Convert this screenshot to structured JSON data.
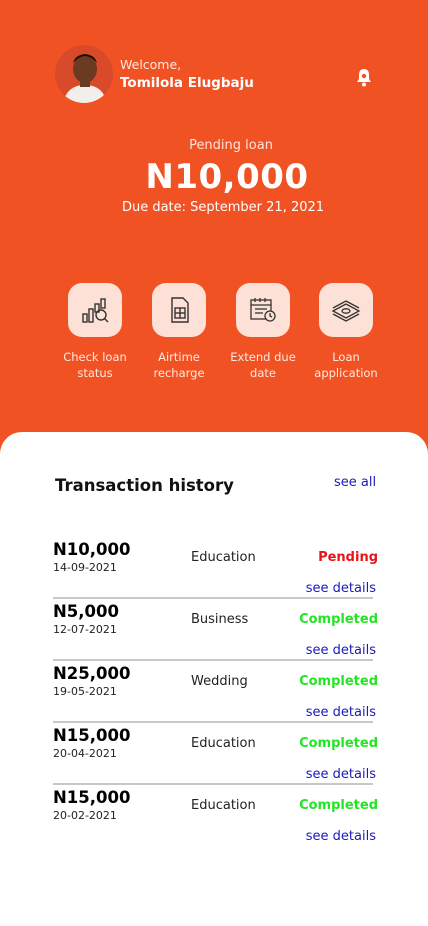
{
  "header": {
    "welcome": "Welcome,",
    "user_name": "Tomilola Elugbaju"
  },
  "loan": {
    "label": "Pending loan",
    "amount": "N10,000",
    "due": "Due date: September 21, 2021"
  },
  "actions": [
    {
      "icon": "search-chart-icon",
      "line1": "Check loan",
      "line2": "status"
    },
    {
      "icon": "sim-card-icon",
      "line1": "Airtime",
      "line2": "recharge"
    },
    {
      "icon": "calendar-clock-icon",
      "line1": "Extend due",
      "line2": "date"
    },
    {
      "icon": "cash-stack-icon",
      "line1": "Loan",
      "line2": "application"
    }
  ],
  "history": {
    "title": "Transaction history",
    "see_all": "see all",
    "items": [
      {
        "amount": "N10,000",
        "date": "14-09-2021",
        "category": "Education",
        "status": "Pending",
        "link": "see details"
      },
      {
        "amount": "N5,000",
        "date": "12-07-2021",
        "category": "Business",
        "status": "Completed",
        "link": "see details"
      },
      {
        "amount": "N25,000",
        "date": "19-05-2021",
        "category": "Wedding",
        "status": "Completed",
        "link": "see details"
      },
      {
        "amount": "N15,000",
        "date": "20-04-2021",
        "category": "Education",
        "status": "Completed",
        "link": "see details"
      },
      {
        "amount": "N15,000",
        "date": "20-02-2021",
        "category": "Education",
        "status": "Completed",
        "link": "see details"
      }
    ]
  },
  "colors": {
    "brand": "#f15224",
    "pending": "#e8141a",
    "completed": "#22e622",
    "link": "#1a1ab8"
  }
}
